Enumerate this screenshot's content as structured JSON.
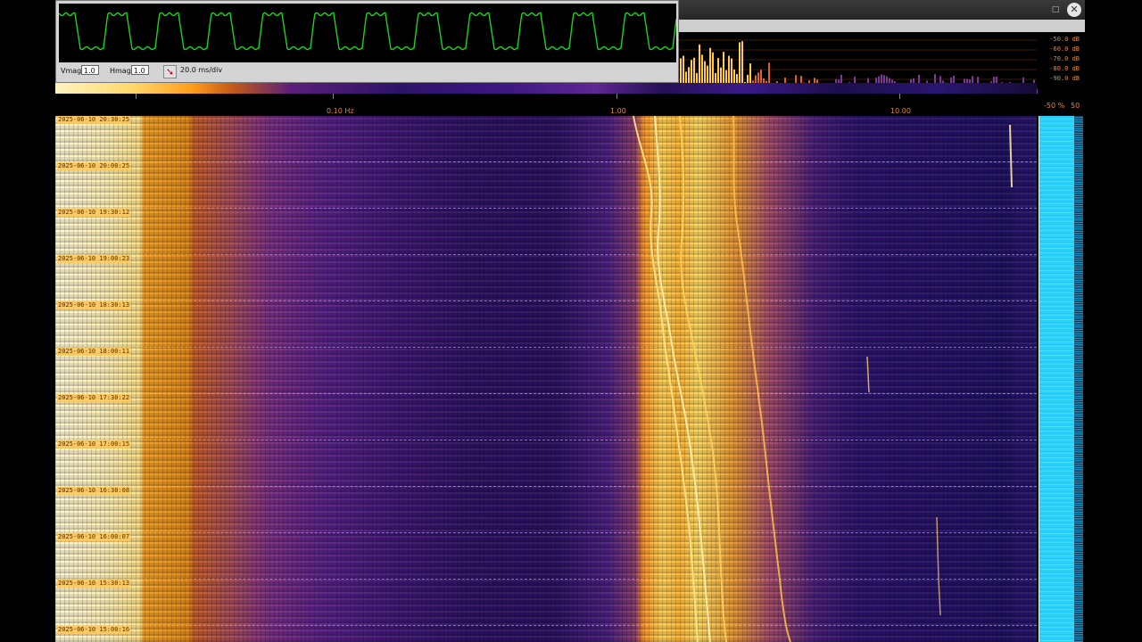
{
  "window": {
    "maximize_icon": "maximize-icon",
    "maximize_glyph": "□",
    "close_icon": "close-icon",
    "close_glyph": "✕"
  },
  "spectrum": {
    "db_labels": [
      "-50.0 dB",
      "-60.0 dB",
      "-70.0 dB",
      "-80.0 dB",
      "-90.0 dB"
    ]
  },
  "frequency_axis": {
    "labels": [
      "0.10 Hz",
      "1.00",
      "10.00"
    ]
  },
  "waterfall": {
    "timestamps": [
      "2025-06-10 20:30:25",
      "2025-06-10 20:00:25",
      "2025-06-10 19:30:12",
      "2025-06-10 19:00:23",
      "2025-06-10 18:30:13",
      "2025-06-10 18:00:11",
      "2025-06-10 17:30:22",
      "2025-06-10 17:00:15",
      "2025-06-10 16:30:08",
      "2025-06-10 16:00:07",
      "2025-06-10 15:30:13",
      "2025-06-10 15:00:16"
    ]
  },
  "percent_panel": {
    "left_label": "-50 %",
    "right_label": "50"
  },
  "scope": {
    "vmag_label": "Vmag",
    "vmag_value": "1.0",
    "hmag_label": "Hmag",
    "hmag_value": "1.0",
    "trigger_icon": "trigger-arrow-icon",
    "trigger_glyph": "➘",
    "timebase": "20.0 ms/div",
    "trace_color": "#1fd21f"
  },
  "colors": {
    "axis_label": "#e08a3a",
    "percent_bar": "#2fd8ff"
  }
}
